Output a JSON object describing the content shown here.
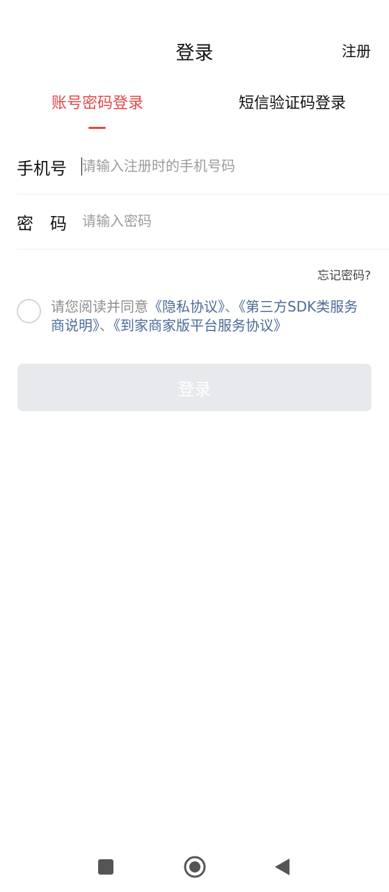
{
  "header": {
    "title": "登录",
    "register_label": "注册"
  },
  "tabs": [
    {
      "label": "账号密码登录",
      "active": true
    },
    {
      "label": "短信验证码登录",
      "active": false
    }
  ],
  "form": {
    "phone": {
      "label": "手机号",
      "placeholder": "请输入注册时的手机号码",
      "value": ""
    },
    "password": {
      "label": "密　码",
      "placeholder": "请输入密码",
      "value": ""
    },
    "forgot_label": "忘记密码?"
  },
  "agreement": {
    "checked": false,
    "prefix": "请您阅读并同意",
    "link1": "《隐私协议》",
    "sep1": "、",
    "link2": "《第三方SDK类服务商说明》",
    "sep2": "、",
    "link3": "《到家商家版平台服务协议》"
  },
  "login_button": {
    "label": "登录",
    "enabled": false
  },
  "navbar": {
    "icons": [
      "square-recent-icon",
      "circle-home-icon",
      "triangle-back-icon"
    ]
  },
  "colors": {
    "accent": "#e24848",
    "link": "#4b6b98",
    "disabled_button": "#e7e9ec"
  }
}
